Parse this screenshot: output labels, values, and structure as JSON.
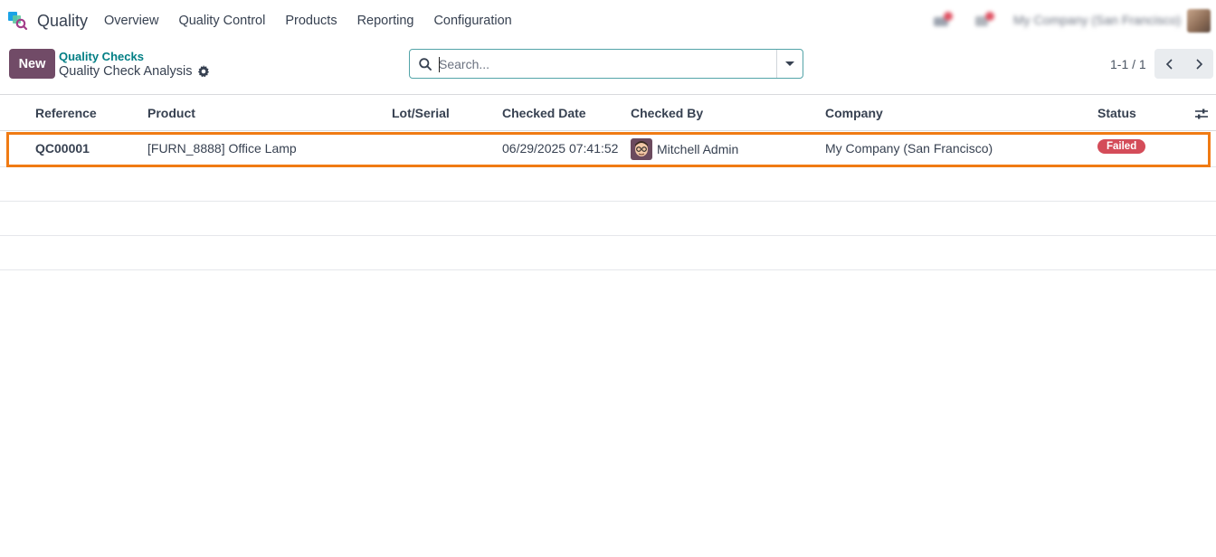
{
  "app": {
    "name": "Quality",
    "icon": "quality-app-icon"
  },
  "menu": [
    {
      "label": "Overview"
    },
    {
      "label": "Quality Control"
    },
    {
      "label": "Products"
    },
    {
      "label": "Reporting"
    },
    {
      "label": "Configuration"
    }
  ],
  "systray": {
    "company": "My Company (San Francisco)",
    "icons": [
      "activity-icon",
      "messages-icon"
    ]
  },
  "control_panel": {
    "new_label": "New",
    "breadcrumb": "Quality Checks",
    "title": "Quality Check Analysis",
    "search_placeholder": "Search...",
    "pager": "1-1 / 1"
  },
  "table": {
    "columns": [
      "Reference",
      "Product",
      "Lot/Serial",
      "Checked Date",
      "Checked By",
      "Company",
      "Status"
    ],
    "rows": [
      {
        "reference": "QC00001",
        "product": "[FURN_8888] Office Lamp",
        "lot_serial": "",
        "checked_date": "06/29/2025 07:41:52",
        "checked_by": "Mitchell Admin",
        "company": "My Company (San Francisco)",
        "status": "Failed"
      }
    ]
  },
  "colors": {
    "brand": "#714b67",
    "breadcrumb": "#017e84",
    "failed_badge": "#d44c59",
    "highlight": "#f07b14"
  }
}
